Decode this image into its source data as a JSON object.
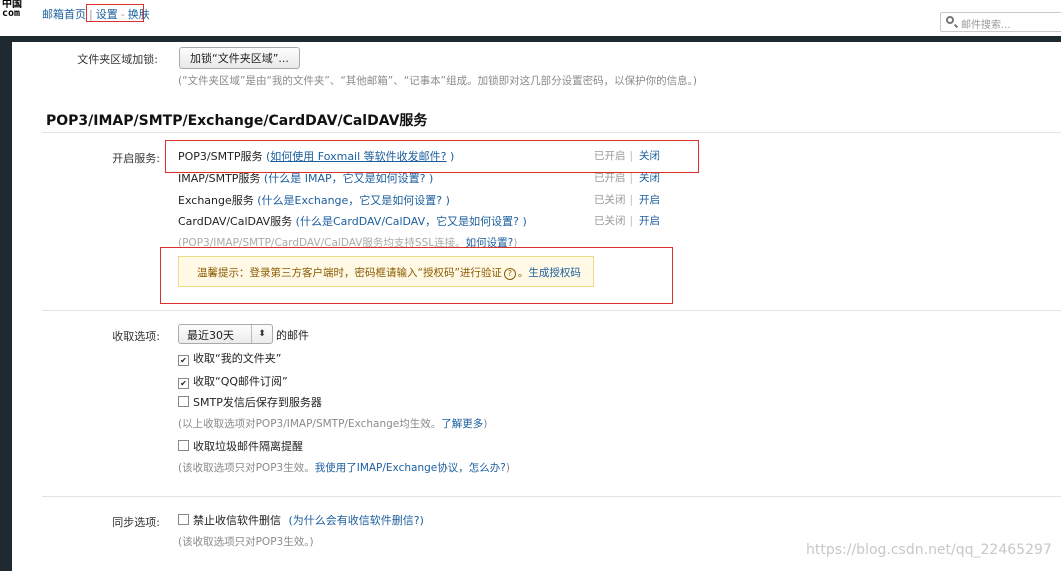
{
  "topbar": {
    "logo_line1": "中国",
    "logo_line2": "com",
    "nav_home": "邮箱首页",
    "nav_sep1": "|",
    "nav_settings": "设置",
    "nav_sep2": "-",
    "nav_skin": "换肤",
    "search_placeholder": "邮件搜索..."
  },
  "folder_lock": {
    "label": "文件夹区域加锁:",
    "button": "加锁“文件夹区域”...",
    "hint": "(“文件夹区域”是由“我的文件夹”、“其他邮箱”、“记事本”组成。加锁即对这几部分设置密码，以保护你的信息。)"
  },
  "services": {
    "title": "POP3/IMAP/SMTP/Exchange/CardDAV/CalDAV服务",
    "label": "开启服务:",
    "items": [
      {
        "name": "POP3/SMTP服务",
        "link_pre": " (",
        "link": "如何使用 Foxmail 等软件收发邮件?",
        "link_post": " )",
        "status": "已开启",
        "action": "关闭"
      },
      {
        "name": "IMAP/SMTP服务",
        "link_pre": " (",
        "link": "什么是 IMAP，它又是如何设置?",
        "link_post": " )",
        "status": "已开启",
        "action": "关闭"
      },
      {
        "name": "Exchange服务",
        "link_pre": " (",
        "link": "什么是Exchange，它又是如何设置?",
        "link_post": " )",
        "status": "已关闭",
        "action": "开启"
      },
      {
        "name": "CardDAV/CalDAV服务",
        "link_pre": " (",
        "link": "什么是CardDAV/CalDAV，它又是如何设置?",
        "link_post": " )",
        "status": "已关闭",
        "action": "开启"
      }
    ],
    "ssl_note": "(POP3/IMAP/SMTP/CardDAV/CalDAV服务均支持SSL连接。",
    "ssl_link": "如何设置?",
    "ssl_close": ")",
    "tip_text": "温馨提示：登录第三方客户端时，密码框请输入“授权码”进行验证",
    "tip_q": "?",
    "tip_dot": "。",
    "tip_link": "生成授权码"
  },
  "receive": {
    "label": "收取选项:",
    "select_value": "最近30天",
    "select_arrow": "⬍",
    "suffix": "的邮件",
    "options": [
      {
        "text": "收取“我的文件夹”",
        "checked": true
      },
      {
        "text": "收取“QQ邮件订阅”",
        "checked": true
      },
      {
        "text": "SMTP发信后保存到服务器",
        "checked": false
      }
    ],
    "note1": "(以上收取选项对POP3/IMAP/SMTP/Exchange均生效。",
    "note1_link": "了解更多",
    "note1_close": ")",
    "spam_option": {
      "text": "收取垃圾邮件隔离提醒",
      "checked": false
    },
    "note2": "(该收取选项只对POP3生效。",
    "note2_link": "我使用了IMAP/Exchange协议，怎么办?",
    "note2_close": ")"
  },
  "sync": {
    "label": "同步选项:",
    "option": {
      "text": "禁止收信软件删信",
      "checked": false
    },
    "option_link": "(为什么会有收信软件删信?)",
    "note": "(该收取选项只对POP3生效。)"
  },
  "watermark": "https://blog.csdn.net/qq_22465297",
  "colors": {
    "link": "#1b5e9e",
    "highlight_border": "#d9302e",
    "tip_bg": "#fff9e6"
  }
}
